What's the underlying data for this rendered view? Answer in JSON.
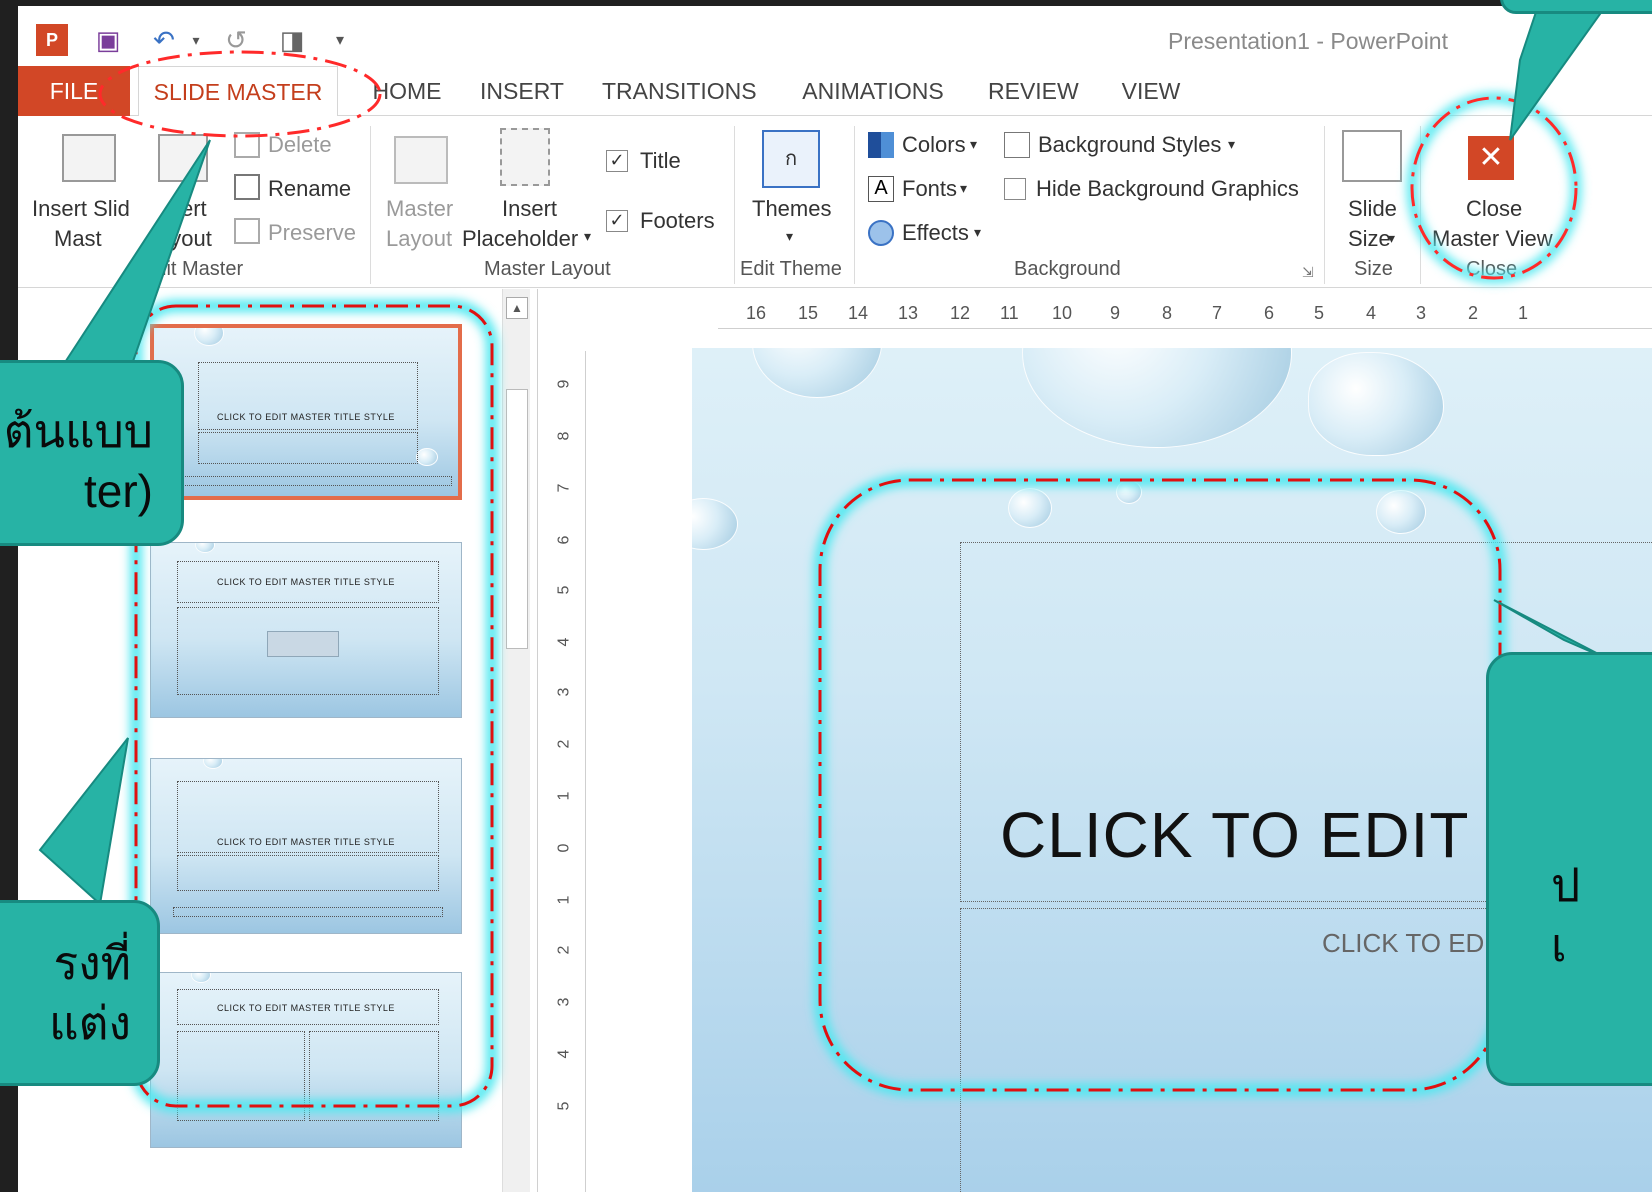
{
  "app": {
    "window_title": "Presentation1 - PowerPoint",
    "qat": [
      "powerpoint-logo-icon",
      "save-icon",
      "undo-icon",
      "redo-icon",
      "start-from-beginning-icon",
      "customize-icon"
    ]
  },
  "tabs": [
    "FILE",
    "SLIDE MASTER",
    "HOME",
    "INSERT",
    "TRANSITIONS",
    "ANIMATIONS",
    "REVIEW",
    "VIEW"
  ],
  "ribbon": {
    "edit_master": {
      "group_label": "Edit Master",
      "insert_slide_master_l1": "Insert Slid",
      "insert_slide_master_l2": "Mast",
      "insert_layout_l1": "sert",
      "insert_layout_l2": "ayout",
      "delete": "Delete",
      "rename": "Rename",
      "preserve": "Preserve"
    },
    "master_layout": {
      "group_label": "Master Layout",
      "master_layout_l1": "Master",
      "master_layout_l2": "Layout",
      "insert_placeholder_l1": "Insert",
      "insert_placeholder_l2": "Placeholder",
      "title_check": "Title",
      "footers_check": "Footers",
      "title_checked": true,
      "footers_checked": true
    },
    "edit_theme": {
      "group_label": "Edit Theme",
      "themes": "Themes"
    },
    "background": {
      "group_label": "Background",
      "colors": "Colors",
      "fonts": "Fonts",
      "effects": "Effects",
      "background_styles": "Background Styles",
      "hide_background_graphics": "Hide Background Graphics"
    },
    "size": {
      "group_label": "Size",
      "slide_size_l1": "Slide",
      "slide_size_l2": "Size"
    },
    "close": {
      "group_label": "Close",
      "close_l1": "Close",
      "close_l2": "Master View"
    }
  },
  "thumbnails": [
    {
      "title": "CLICK TO EDIT MASTER TITLE STYLE",
      "selected": true
    },
    {
      "title": "CLICK TO EDIT MASTER TITLE STYLE",
      "selected": false
    },
    {
      "title": "CLICK TO EDIT MASTER TITLE STYLE",
      "selected": false
    },
    {
      "title": "CLICK TO EDIT MASTER TITLE STYLE",
      "selected": false
    }
  ],
  "ruler": {
    "horizontal": [
      "16",
      "15",
      "14",
      "13",
      "12",
      "11",
      "10",
      "9",
      "8",
      "7",
      "6",
      "5",
      "4",
      "3",
      "2",
      "1"
    ],
    "vertical": [
      "9",
      "8",
      "7",
      "6",
      "5",
      "4",
      "3",
      "2",
      "1",
      "0",
      "1",
      "2",
      "3",
      "4",
      "5"
    ]
  },
  "slide": {
    "title": "CLICK TO EDIT",
    "subtitle": "CLICK TO ED"
  },
  "callouts": {
    "master_l1": "ต้นแบบ",
    "master_l2": "ter)",
    "layouts_l1": "รงที่",
    "layouts_l2": "แต่ง",
    "right_l1": "ป",
    "right_l2": "เ"
  },
  "colors": {
    "accent": "#d24726",
    "highlight_dash": "#e01010",
    "glow": "#4de8f0",
    "callout": "#27b3a5"
  }
}
